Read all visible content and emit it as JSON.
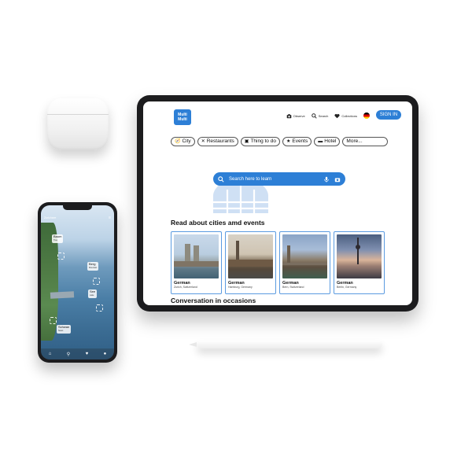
{
  "tablet": {
    "logo_text": "Multi Multi",
    "nav": [
      {
        "label": "Observe",
        "icon": "camera-icon"
      },
      {
        "label": "Search",
        "icon": "search-icon"
      },
      {
        "label": "Collections",
        "icon": "heart-icon"
      }
    ],
    "language_flag": "german-flag-icon",
    "sign_in": "SIGN IN",
    "categories": [
      {
        "label": "City",
        "icon": "compass-icon"
      },
      {
        "label": "Restaurants",
        "icon": "utensils-icon"
      },
      {
        "label": "Thing to do",
        "icon": "map-icon"
      },
      {
        "label": "Events",
        "icon": "star-icon"
      },
      {
        "label": "Hotel",
        "icon": "bed-icon"
      },
      {
        "label": "More...",
        "icon": ""
      }
    ],
    "search": {
      "placeholder": "Search here to learn"
    },
    "section_city_title": "Read about cities amd events",
    "cards": [
      {
        "language": "German",
        "location": "Zurich, Switzerland"
      },
      {
        "language": "German",
        "location": "Hamburg, Germany"
      },
      {
        "language": "German",
        "location": "Bern, Switzerland"
      },
      {
        "language": "German",
        "location": "Berlin, Germany"
      }
    ],
    "section_conversation_title": "Conversation in occasions"
  },
  "phone": {
    "top_left": "Zurichsee",
    "tags": [
      {
        "label": "Baum",
        "sub": "Tree"
      },
      {
        "label": "Berg",
        "sub": "Mountain"
      },
      {
        "label": "See",
        "sub": "Lake"
      },
      {
        "label": "Schwan",
        "sub": "Swan"
      }
    ],
    "tabbar": [
      "home-icon",
      "search-icon",
      "heart-icon",
      "profile-icon"
    ]
  },
  "colors": {
    "accent": "#2d7fd6",
    "card_border": "#5b9be0"
  }
}
